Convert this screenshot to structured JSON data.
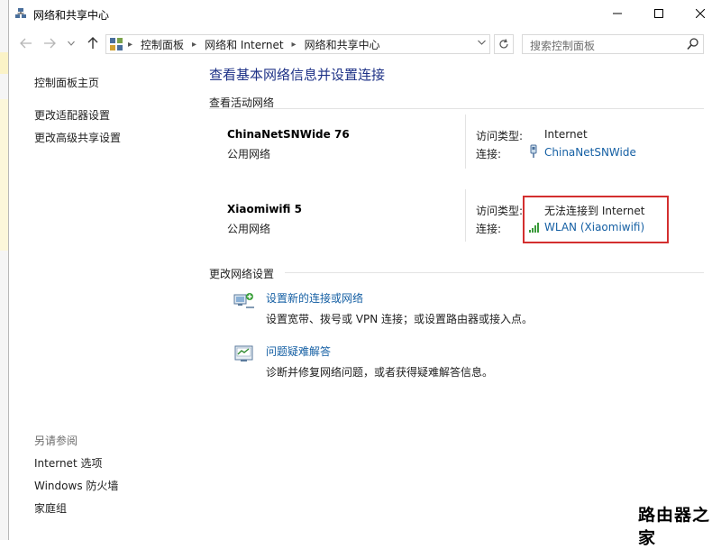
{
  "window": {
    "title": "网络和共享中心"
  },
  "nav": {
    "breadcrumbs": [
      "控制面板",
      "网络和 Internet",
      "网络和共享中心"
    ],
    "search_placeholder": "搜索控制面板"
  },
  "sidebar": {
    "items": [
      {
        "label": "控制面板主页"
      },
      {
        "label": "更改适配器设置"
      },
      {
        "label": "更改高级共享设置"
      }
    ],
    "see_also_title": "另请参阅",
    "see_also": [
      {
        "label": "Internet 选项"
      },
      {
        "label": "Windows 防火墙"
      },
      {
        "label": "家庭组"
      }
    ]
  },
  "main": {
    "title": "查看基本网络信息并设置连接",
    "active_networks_label": "查看活动网络",
    "networks": [
      {
        "name": "ChinaNetSNWide   76",
        "type": "公用网络",
        "access_key": "访问类型:",
        "access_value": "Internet",
        "conn_key": "连接:",
        "conn_value": "ChinaNetSNWide",
        "conn_icon": "ethernet-icon"
      },
      {
        "name": "Xiaomiwifi   5",
        "type": "公用网络",
        "access_key": "访问类型:",
        "access_value": "无法连接到 Internet",
        "conn_key": "连接:",
        "conn_value": "WLAN (Xiaomiwifi)",
        "conn_icon": "wifi-signal-icon"
      }
    ],
    "change_settings_label": "更改网络设置",
    "tasks": [
      {
        "link": "设置新的连接或网络",
        "desc": "设置宽带、拨号或 VPN 连接；或设置路由器或接入点。",
        "icon": "new-connection-icon"
      },
      {
        "link": "问题疑难解答",
        "desc": "诊断并修复网络问题，或者获得疑难解答信息。",
        "icon": "troubleshoot-icon"
      }
    ]
  },
  "watermark": "路由器之家",
  "colors": {
    "link": "#1660a4",
    "title": "#1e3287",
    "highlight_box": "#d32f2f"
  }
}
